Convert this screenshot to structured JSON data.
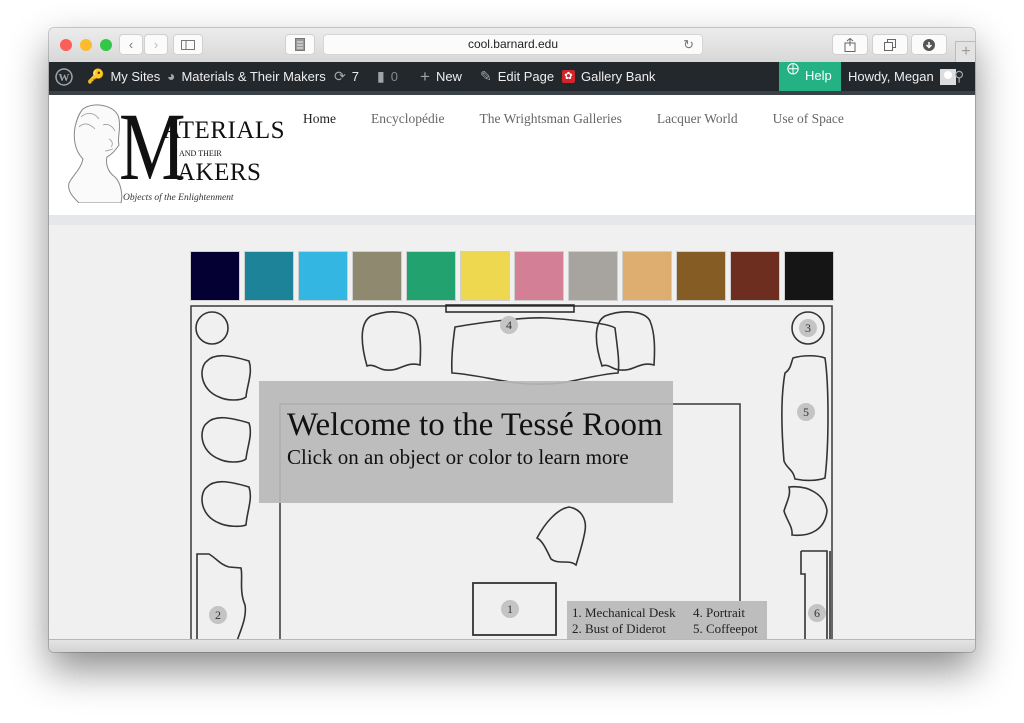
{
  "browser": {
    "url": "cool.barnard.edu",
    "icons": {
      "back": "chevron-left",
      "forward": "chevron-right",
      "sidebar": "sidebar",
      "reader": "reader",
      "reload": "reload",
      "share": "share",
      "tabs": "tabs",
      "download": "download",
      "new_tab": "plus"
    }
  },
  "adminbar": {
    "my_sites": "My Sites",
    "site_name": "Materials & Their Makers",
    "updates_count": "7",
    "comments_count": "0",
    "new_label": "New",
    "edit_page": "Edit Page",
    "gallery_bank": "Gallery Bank",
    "help": "Help",
    "howdy": "Howdy, Megan",
    "colors": {
      "bar": "#23282d",
      "help": "#24b285",
      "gallery_icon": "#d1252a"
    }
  },
  "site": {
    "logo": {
      "line1_initial": "M",
      "line1_rest": "ATERIALS",
      "and_their": "AND THEIR",
      "line2_rest": "AKERS",
      "tagline": "Objects of the Enlightenment"
    },
    "nav": [
      {
        "label": "Home",
        "active": true
      },
      {
        "label": "Encyclopédie",
        "active": false
      },
      {
        "label": "The Wrightsman Galleries",
        "active": false
      },
      {
        "label": "Lacquer World",
        "active": false
      },
      {
        "label": "Use of Space",
        "active": false
      }
    ]
  },
  "palette": {
    "swatches": [
      "#040033",
      "#1d8399",
      "#33b7e2",
      "#8f8a6f",
      "#22a26f",
      "#eed84f",
      "#d38096",
      "#a7a49f",
      "#ddae6f",
      "#845c24",
      "#6d2e1f",
      "#151515"
    ]
  },
  "room": {
    "welcome_title": "Welcome to the Tessé Room",
    "welcome_subtitle": "Click on an object or color to learn more",
    "markers": [
      "1",
      "2",
      "3",
      "4",
      "5",
      "6"
    ],
    "legend": [
      "1. Mechanical Desk",
      "2. Bust of Diderot",
      "4. Portrait",
      "5. Coffeepot"
    ]
  }
}
